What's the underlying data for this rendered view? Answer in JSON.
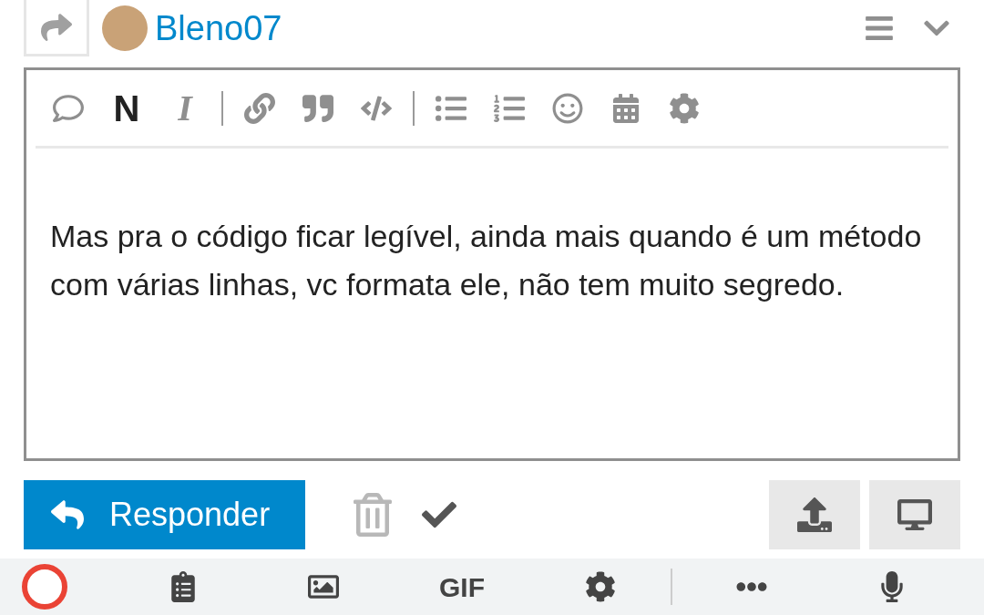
{
  "post_header": {
    "username": "Bleno07"
  },
  "toolbar": [
    {
      "kind": "quote"
    },
    {
      "kind": "bold",
      "label": "N"
    },
    {
      "kind": "italic",
      "label": "I"
    },
    {
      "kind": "divider"
    },
    {
      "kind": "link"
    },
    {
      "kind": "blockquote"
    },
    {
      "kind": "code"
    },
    {
      "kind": "divider"
    },
    {
      "kind": "bullets"
    },
    {
      "kind": "numbers"
    },
    {
      "kind": "emoji"
    },
    {
      "kind": "calendar"
    },
    {
      "kind": "settings"
    }
  ],
  "editor": {
    "text": "Mas pra o código ficar legível, ainda mais quando é um método com várias linhas, vc formata ele, não tem muito segredo."
  },
  "actions": {
    "reply_label": "Responder"
  },
  "keyboard_bar": {
    "gif_label": "GIF"
  }
}
